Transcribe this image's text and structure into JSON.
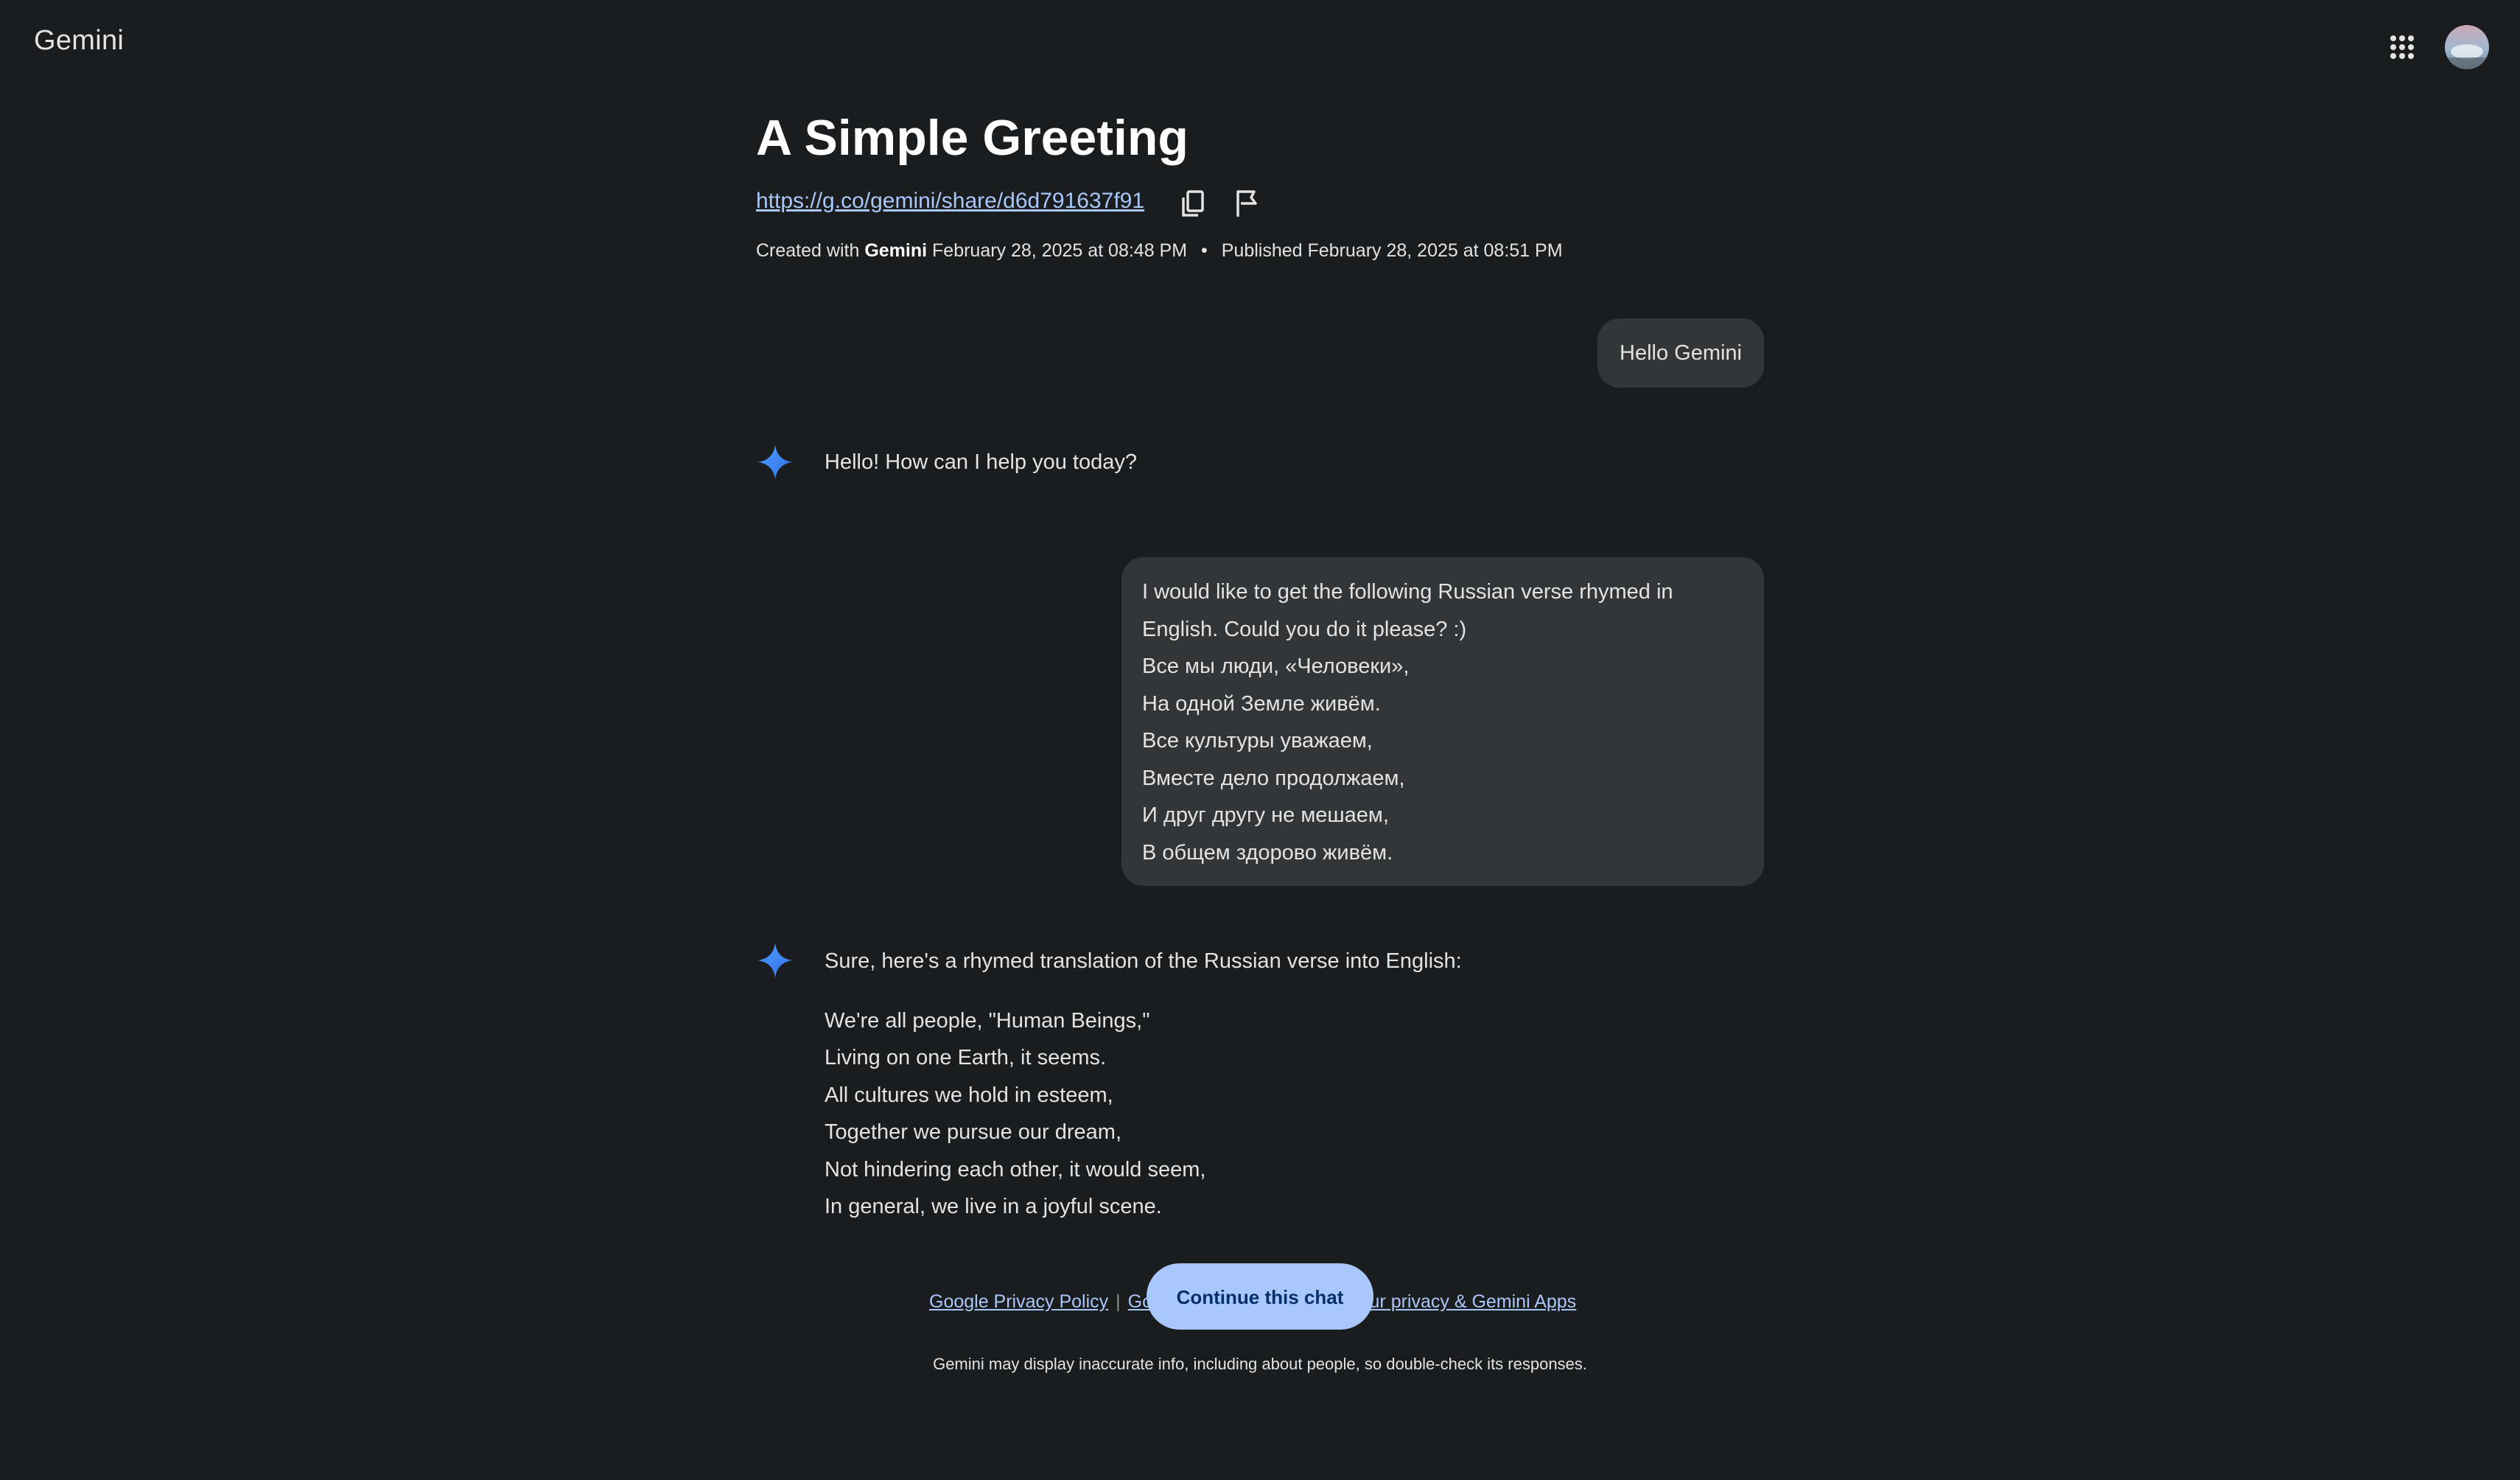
{
  "header": {
    "brand": "Gemini",
    "apps_icon": "apps-grid-icon",
    "avatar_icon": "account-avatar"
  },
  "conversation": {
    "title": "A Simple Greeting",
    "share_url": "https://g.co/gemini/share/d6d791637f91",
    "meta": {
      "created_prefix": "Created with",
      "created_app": "Gemini",
      "created_date": "February 28, 2025 at 08:48 PM",
      "separator": "•",
      "published": "Published February 28, 2025 at 08:51 PM"
    },
    "messages": [
      {
        "role": "user",
        "text": "Hello Gemini"
      },
      {
        "role": "model",
        "text": "Hello! How can I help you today?"
      },
      {
        "role": "user",
        "lines": [
          "I would like to get the following Russian verse rhymed in",
          "English. Could you do it please? :)",
          "Все мы люди, «Человеки»,",
          "На одной Земле живём.",
          "Все культуры уважаем,",
          "Вместе дело продолжаем,",
          "И друг другу не мешаем,",
          "В общем здорово живём."
        ]
      },
      {
        "role": "model",
        "intro": "Sure, here's a rhymed translation of the Russian verse into English:",
        "lines": [
          "We're all people, \"Human Beings,\"",
          "Living on one Earth, it seems.",
          "All cultures we hold in esteem,",
          "Together we pursue our dream,",
          "Not hindering each other, it would seem,",
          "In general, we live in a joyful scene."
        ]
      }
    ]
  },
  "footer": {
    "privacy_link": "Google Privacy Policy",
    "separator": "|",
    "terms_link_visible": "Gc",
    "gemini_privacy_link_visible": "our privacy & Gemini Apps",
    "continue_button": "Continue this chat",
    "disclaimer": "Gemini may display inaccurate info, including about people, so double-check its responses."
  },
  "colors": {
    "background": "#1b1c1d",
    "bubble": "#333537",
    "link": "#a8c7fa",
    "button_bg": "#a8c7fa",
    "button_text": "#062e6f",
    "spark_blue": "#4285f4"
  }
}
